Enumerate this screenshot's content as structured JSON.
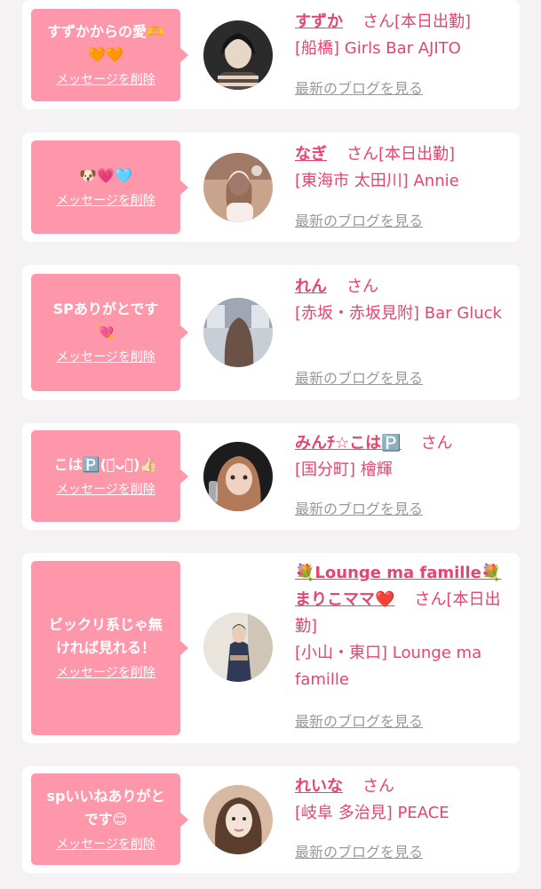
{
  "entries": [
    {
      "message": "すずかからの愛🫶\n🧡🧡",
      "delete_label": "メッセージを削除",
      "name": "すずか",
      "honorific": "さん",
      "status": "[本日出勤]",
      "shop": "[船橋] Girls Bar AJITO",
      "blog_label": "最新のブログを見る",
      "avatar_colors": [
        "#2b2b2b",
        "#e7d7c8",
        "#5a4a40"
      ]
    },
    {
      "message": "🐶💗🩵",
      "delete_label": "メッセージを削除",
      "name": "なぎ",
      "honorific": "さん",
      "status": "[本日出勤]",
      "shop": "[東海市 太田川] Annie",
      "blog_label": "最新のブログを見る",
      "avatar_colors": [
        "#c9a48d",
        "#f2e6df",
        "#8a5e4b"
      ]
    },
    {
      "message": "SPありがとです\n💘",
      "delete_label": "メッセージを削除",
      "name": "れん",
      "honorific": "さん",
      "status": "",
      "shop": "[赤坂・赤坂見附] Bar Gluck",
      "blog_label": "最新のブログを見る",
      "avatar_colors": [
        "#9ea7b3",
        "#6b5246",
        "#c8ced6"
      ]
    },
    {
      "message": "こは🅿️(・᷄ᴗ・᷅)👍🏻",
      "delete_label": "メッセージを削除",
      "name": "みんﾁ☆こは🅿️",
      "honorific": "さん",
      "status": "",
      "shop": "[国分町] 檜輝",
      "blog_label": "最新のブログを見る",
      "avatar_colors": [
        "#1c1c1c",
        "#f0d2c2",
        "#b37a5a"
      ]
    },
    {
      "message": "ビックリ系じゃ無\nければ見れる！",
      "delete_label": "メッセージを削除",
      "name_prefix": "💐Lounge ma famille💐",
      "name": "まりこママ❤️",
      "honorific": "さん",
      "status": "[本日出勤]",
      "shop": "[小山・東口] Lounge ma famille",
      "blog_label": "最新のブログを見る",
      "avatar_colors": [
        "#e9e4dc",
        "#2f3a56",
        "#b99f83"
      ]
    },
    {
      "message": "spいいねありがと\nです😊",
      "delete_label": "メッセージを削除",
      "name": "れいな",
      "honorific": "さん",
      "status": "",
      "shop": "[岐阜 多治見] PEACE",
      "blog_label": "最新のブログを見る",
      "avatar_colors": [
        "#d8b9a4",
        "#5b3d2e",
        "#f3e3d6"
      ]
    }
  ],
  "colors": {
    "bubble": "#ff97ab",
    "accent": "#e5456e",
    "link_gray": "#999999",
    "background": "#f4f2f3"
  }
}
